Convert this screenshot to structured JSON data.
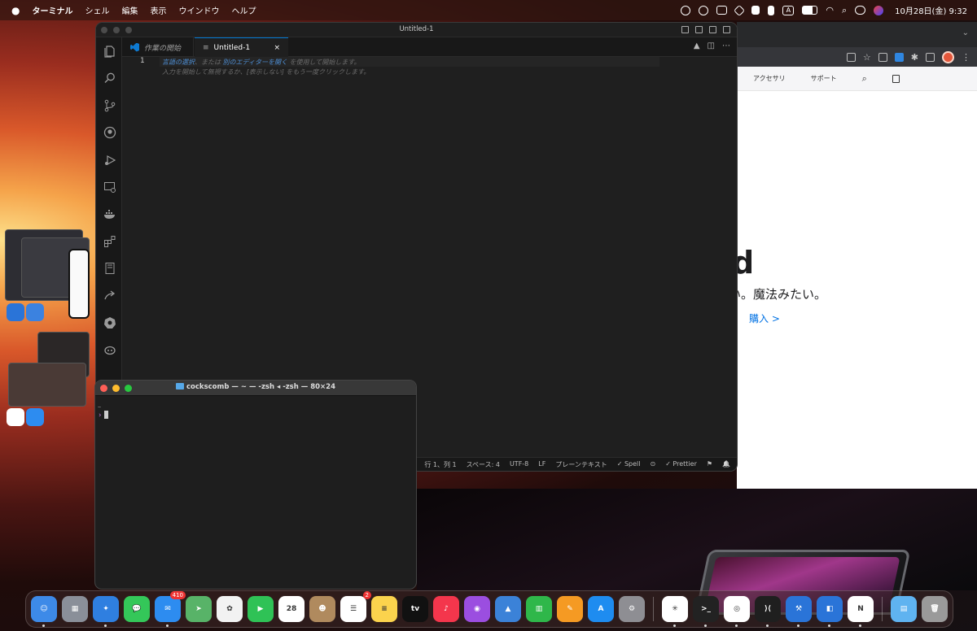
{
  "menubar": {
    "app_name": "ターミナル",
    "menus": [
      "シェル",
      "編集",
      "表示",
      "ウインドウ",
      "ヘルプ"
    ],
    "clock": "10月28日(金)  9:32",
    "status_icons": [
      "creative-cloud-icon",
      "screen-record-icon",
      "display-icon",
      "dropbox-icon",
      "evernote-icon",
      "battery-icon",
      "input-method-icon",
      "wifi-icon",
      "search-icon",
      "control-center-icon",
      "siri-icon"
    ],
    "input_method": "A"
  },
  "browser": {
    "tab_overflow": "⌄",
    "nav": [
      "アクセサリ",
      "サポート"
    ],
    "hero_title_fragment": "d",
    "hero_subtitle_fragment": "い。魔法みたい。",
    "hero_link": "購入 >"
  },
  "vscode": {
    "window_title": "Untitled-1",
    "tabs": [
      {
        "label": "作業の開始"
      },
      {
        "label": "Untitled-1",
        "close": "×"
      }
    ],
    "line_number": "1",
    "hint_part1_link": "言語の選択",
    "hint_part2": "、または ",
    "hint_part3_link": "別のエディターを開く",
    "hint_part4": " を使用して開始します。",
    "hint_line2": "入力を開始して無視するか、[表示しない] をもう一度クリックします。",
    "tab_actions": [
      "▲",
      "◫",
      "⋯"
    ],
    "activity_bar": [
      "explorer",
      "search",
      "source-control",
      "github",
      "run-debug",
      "remote-explorer",
      "docker",
      "extensions",
      "notebook",
      "live-share",
      "kubernetes",
      "copilot"
    ],
    "status": {
      "position": "行 1、列 1",
      "spaces": "スペース: 4",
      "encoding": "UTF-8",
      "eol": "LF",
      "language": "プレーンテキスト",
      "spell": "✓ Spell",
      "copilot": "⊙",
      "prettier": "✓ Prettier",
      "feedback": "⚑",
      "bell": "🔔"
    }
  },
  "terminal": {
    "title": "cockscomb — ~ — -zsh ◂ -zsh — 80×24",
    "line1": "~",
    "prompt": "›"
  },
  "dock": {
    "apps": [
      {
        "name": "Finder",
        "color": "#3d8ae8",
        "glyph": "☺"
      },
      {
        "name": "Launchpad",
        "color": "#8a8f99",
        "glyph": "▦"
      },
      {
        "name": "Safari",
        "color": "#2f7fe0",
        "glyph": "✦"
      },
      {
        "name": "Messages",
        "color": "#34c759",
        "glyph": "💬"
      },
      {
        "name": "Mail",
        "color": "#2d8cf0",
        "glyph": "✉",
        "badge": "410"
      },
      {
        "name": "Maps",
        "color": "#58b368",
        "glyph": "➤"
      },
      {
        "name": "Photos",
        "color": "#f2f2f2",
        "glyph": "✿"
      },
      {
        "name": "FaceTime",
        "color": "#2fc256",
        "glyph": "▶"
      },
      {
        "name": "Calendar",
        "color": "#ffffff",
        "glyph": "28"
      },
      {
        "name": "Contacts",
        "color": "#b08a5e",
        "glyph": "☻"
      },
      {
        "name": "Reminders",
        "color": "#ffffff",
        "glyph": "☰",
        "badge": "2"
      },
      {
        "name": "Notes",
        "color": "#fbd34d",
        "glyph": "≡"
      },
      {
        "name": "TV",
        "color": "#111111",
        "glyph": "tv"
      },
      {
        "name": "Music",
        "color": "#f4364c",
        "glyph": "♪"
      },
      {
        "name": "Podcasts",
        "color": "#9b4ee0",
        "glyph": "◉"
      },
      {
        "name": "Keynote",
        "color": "#3b82d8",
        "glyph": "▲"
      },
      {
        "name": "Numbers",
        "color": "#2fb74a",
        "glyph": "▥"
      },
      {
        "name": "Pages",
        "color": "#f59a23",
        "glyph": "✎"
      },
      {
        "name": "App Store",
        "color": "#1e8cf0",
        "glyph": "A"
      },
      {
        "name": "System Settings",
        "color": "#8e8e93",
        "glyph": "⚙"
      }
    ],
    "running_apps": [
      {
        "name": "Slack",
        "color": "#ffffff",
        "glyph": "✳"
      },
      {
        "name": "Terminal",
        "color": "#222222",
        "glyph": ">_"
      },
      {
        "name": "Chrome",
        "color": "#ffffff",
        "glyph": "◎"
      },
      {
        "name": "VS Code",
        "color": "#1f1f1f",
        "glyph": "⟩⟨"
      },
      {
        "name": "Xcode",
        "color": "#2a74d8",
        "glyph": "⚒"
      },
      {
        "name": "Simulator",
        "color": "#2a74d8",
        "glyph": "◧"
      },
      {
        "name": "Notion",
        "color": "#ffffff",
        "glyph": "N"
      }
    ],
    "trailing": [
      {
        "name": "Downloads",
        "color": "#5fb3f0",
        "glyph": "▤"
      },
      {
        "name": "Trash",
        "color": "#9a9a9a",
        "glyph": "🗑"
      }
    ]
  }
}
